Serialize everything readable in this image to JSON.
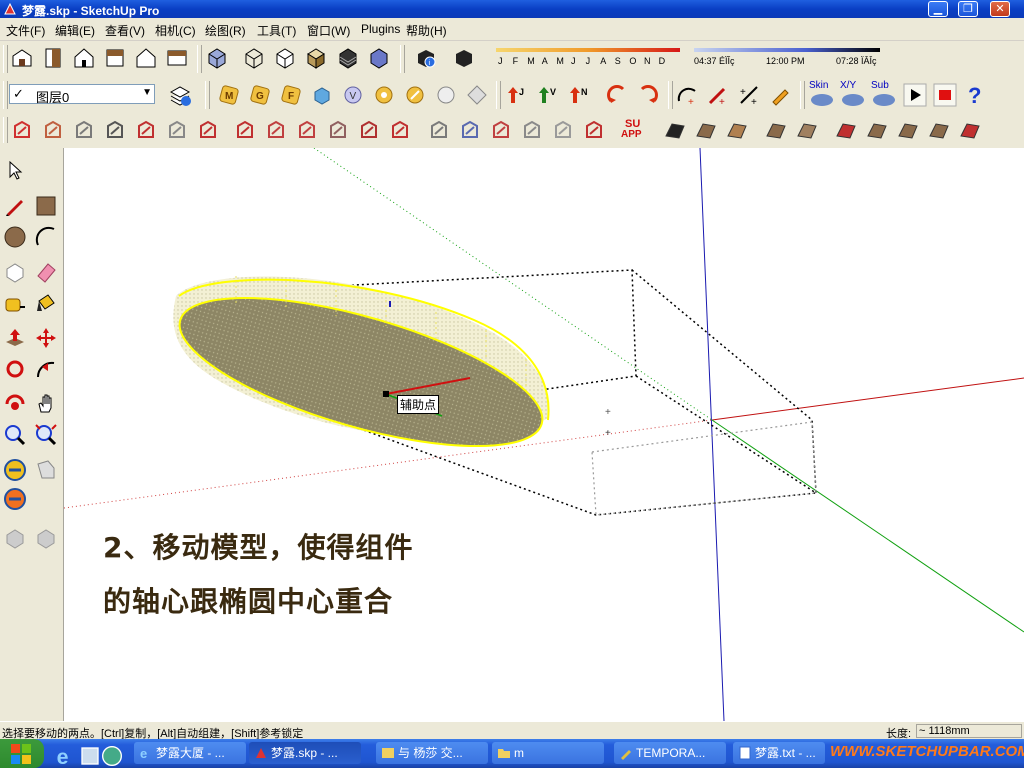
{
  "window": {
    "title": "梦露.skp - SketchUp Pro"
  },
  "menu": [
    "文件(F)",
    "编辑(E)",
    "查看(V)",
    "相机(C)",
    "绘图(R)",
    "工具(T)",
    "窗口(W)",
    "Plugins",
    "帮助(H)"
  ],
  "shadow": {
    "months": [
      "J",
      "F",
      "M",
      "A",
      "M",
      "J",
      "J",
      "A",
      "S",
      "O",
      "N",
      "D"
    ],
    "time_start": "04:37 ÉÏÎç",
    "time_mid": "12:00 PM",
    "time_end": "07:28 ÏÂÎç"
  },
  "layer": {
    "checked": "✓",
    "name": "图层0"
  },
  "plugin_labels": {
    "skin": "Skin",
    "xy": "X/Y",
    "sub": "Sub",
    "su": "SU",
    "app": "APP"
  },
  "viewport": {
    "tooltip": "辅助点",
    "annotation_line1": "2、移动模型，使得组件",
    "annotation_line2": "的轴心跟椭圆中心重合"
  },
  "status": {
    "hint": "选择要移动的两点。[Ctrl]复制，[Alt]自动组建，[Shift]参考锁定",
    "length_label": "长度:",
    "length_value": "~ 1118mm"
  },
  "taskbar": {
    "tasks": [
      "梦露大厦 - ...",
      "梦露.skp - ...",
      "与 杨莎 交...",
      "m",
      "TEMPORA...",
      "梦露.txt - ..."
    ],
    "watermark": "WWW.SKETCHUPBAR.COM"
  },
  "colors": {
    "titlebar": "#0a3fc4",
    "chrome": "#ece9d8",
    "taskbar": "#245ddb",
    "selection": "#ffff00"
  }
}
